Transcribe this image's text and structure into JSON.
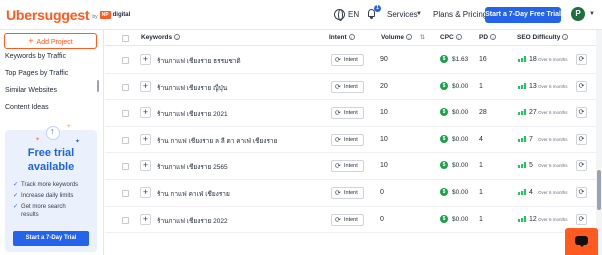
{
  "header": {
    "logo_text": "Ubersuggest",
    "logo_by": "by",
    "logo_np": "NP",
    "logo_digital": "digital",
    "language": "EN",
    "notification_count": "1",
    "services_label": "Services",
    "plans_label": "Plans & Pricing",
    "trial_button": "Start a 7-Day Free Trial",
    "avatar_letter": "P"
  },
  "sidebar": {
    "add_project": "Add Project",
    "items": [
      {
        "label": "Keywords by Traffic"
      },
      {
        "label": "Top Pages by Traffic"
      },
      {
        "label": "Similar Websites"
      },
      {
        "label": "Content Ideas"
      }
    ],
    "trial_card": {
      "title_line1": "Free trial",
      "title_line2": "available",
      "features": [
        "Track more keywords",
        "Increase daily limits",
        "Get more search",
        "results"
      ],
      "button": "Start a 7-Day Trial"
    }
  },
  "table": {
    "columns": {
      "keywords": "Keywords",
      "intent": "Intent",
      "volume": "Volume",
      "cpc": "CPC",
      "pd": "PD",
      "sd": "SEO Difficulty"
    },
    "intent_label": "Intent",
    "updated_text": "Over 6 months",
    "rows": [
      {
        "keyword": "ร้านกาแฟ เชียงราย ธรรมชาติ",
        "volume": "90",
        "cpc": "$1.63",
        "pd": "16",
        "sd": "18"
      },
      {
        "keyword": "ร้านกาแฟ เชียงราย ญี่ปุ่น",
        "volume": "20",
        "cpc": "$0.00",
        "pd": "1",
        "sd": "13"
      },
      {
        "keyword": "ร้านกาแฟ เชียงราย 2021",
        "volume": "10",
        "cpc": "$0.00",
        "pd": "28",
        "sd": "27"
      },
      {
        "keyword": "ร้าน กาแฟ เชียงราย ล ลี ตา คาเฟ่ เชียงราย",
        "volume": "10",
        "cpc": "$0.00",
        "pd": "4",
        "sd": "7"
      },
      {
        "keyword": "ร้านกาแฟ เชียงราย 2565",
        "volume": "10",
        "cpc": "$0.00",
        "pd": "1",
        "sd": "5"
      },
      {
        "keyword": "ร้าน กาแฟ คาเฟ่ เชียงราย",
        "volume": "0",
        "cpc": "$0.00",
        "pd": "1",
        "sd": "4"
      },
      {
        "keyword": "ร้านกาแฟ เชียงราย 2022",
        "volume": "0",
        "cpc": "$0.00",
        "pd": "1",
        "sd": "12"
      }
    ]
  },
  "colors": {
    "brand": "#ff5a1f",
    "primary": "#2563eb",
    "cpc_green": "#16a34a",
    "sd_green": "#22c55e"
  }
}
